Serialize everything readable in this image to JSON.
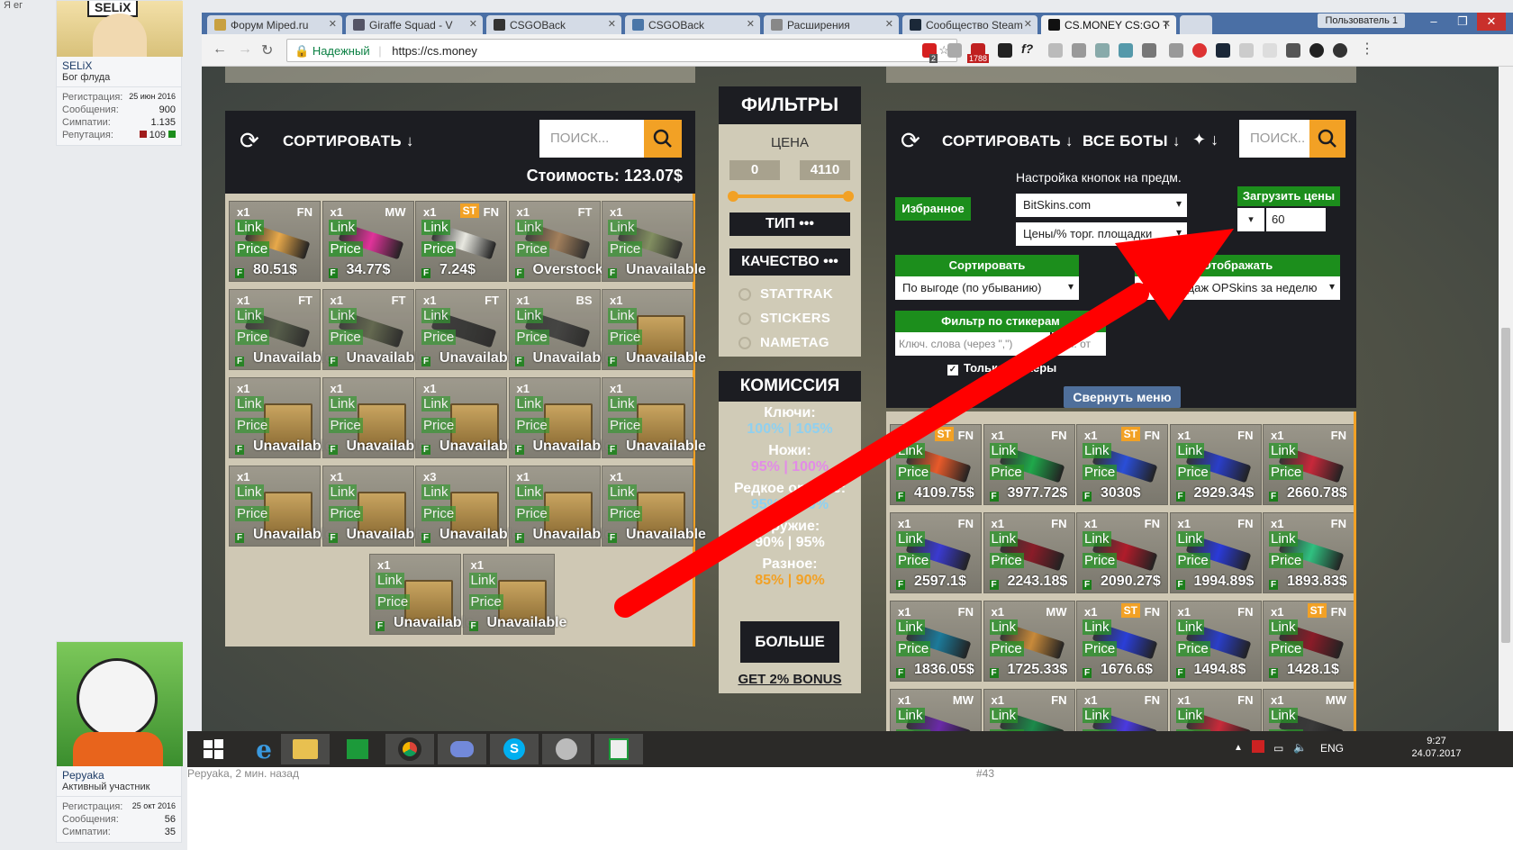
{
  "forum": {
    "top_text": "Я ег",
    "users": [
      {
        "name": "SELiX",
        "title": "Бог флуда",
        "avatar_text": "SELiX",
        "stats": [
          {
            "label": "Регистрация:",
            "value": "25 июн 2016"
          },
          {
            "label": "Сообщения:",
            "value": "900"
          },
          {
            "label": "Симпатии:",
            "value": "1.135"
          },
          {
            "label": "Репутация:",
            "value": "109"
          }
        ]
      },
      {
        "name": "Pepyaka",
        "title": "Активный участник",
        "stats": [
          {
            "label": "Регистрация:",
            "value": "25 окт 2016"
          },
          {
            "label": "Сообщения:",
            "value": "56"
          },
          {
            "label": "Симпатии:",
            "value": "35"
          }
        ]
      }
    ],
    "post_meta": "Pepyaka, 2 мин. назад",
    "post_number": "#43"
  },
  "browser": {
    "tabs": [
      {
        "label": "Форум Miped.ru",
        "active": false
      },
      {
        "label": "Giraffe Squad - V",
        "active": false
      },
      {
        "label": "CSGOBack",
        "active": false
      },
      {
        "label": "CSGOBack",
        "active": false
      },
      {
        "label": "Расширения",
        "active": false
      },
      {
        "label": "Сообщество Steam",
        "active": false
      },
      {
        "label": "CS.MONEY CS:GO T",
        "active": true
      }
    ],
    "user_badge": "Пользователь 1",
    "secure_label": "Надежный",
    "url": "https://cs.money",
    "ext_badge_1": "2",
    "ext_badge_2": "1788"
  },
  "left_panel": {
    "sort_label": "СОРТИРОВАТЬ",
    "search_placeholder": "ПОИСК...",
    "total_label": "Стоимость: 123.07$",
    "items": [
      {
        "qty": "x1",
        "wear": "FN",
        "price": "80.51$",
        "type": "gun",
        "color": "#e8a94a"
      },
      {
        "qty": "x1",
        "wear": "MW",
        "price": "34.77$",
        "type": "gun",
        "color": "#e0339a"
      },
      {
        "qty": "x1",
        "wear": "FN",
        "st": "ST",
        "price": "7.24$",
        "type": "gun",
        "color": "#e8e8e0"
      },
      {
        "qty": "x1",
        "wear": "FT",
        "price": "Overstock",
        "type": "gun",
        "color": "#a07a55",
        "dim": true
      },
      {
        "qty": "x1",
        "wear": "",
        "price": "Unavailable",
        "type": "gun",
        "color": "#7c8a5a",
        "dim": true
      },
      {
        "qty": "x1",
        "wear": "FT",
        "price": "Unavailable",
        "type": "gun",
        "color": "#4d5542",
        "dim": true
      },
      {
        "qty": "x1",
        "wear": "FT",
        "price": "Unavailable",
        "type": "gun",
        "color": "#5b6148",
        "dim": true
      },
      {
        "qty": "x1",
        "wear": "FT",
        "price": "Unavailable",
        "type": "gun",
        "color": "#2e2e2e",
        "dim": true
      },
      {
        "qty": "x1",
        "wear": "BS",
        "price": "Unavailable",
        "type": "gun",
        "color": "#3a3a3a",
        "dim": true
      },
      {
        "qty": "x1",
        "wear": "",
        "price": "Unavailable",
        "type": "box",
        "dim": true
      },
      {
        "qty": "x1",
        "wear": "",
        "price": "Unavailable",
        "type": "box",
        "dim": true
      },
      {
        "qty": "x1",
        "wear": "",
        "price": "Unavailable",
        "type": "box",
        "dim": true
      },
      {
        "qty": "x1",
        "wear": "",
        "price": "Unavailable",
        "type": "box",
        "dim": true
      },
      {
        "qty": "x1",
        "wear": "",
        "price": "Unavailable",
        "type": "box",
        "dim": true
      },
      {
        "qty": "x1",
        "wear": "",
        "price": "Unavailable",
        "type": "box",
        "dim": true
      },
      {
        "qty": "x1",
        "wear": "",
        "price": "Unavailable",
        "type": "box",
        "dim": true
      },
      {
        "qty": "x1",
        "wear": "",
        "price": "Unavailable",
        "type": "box",
        "dim": true
      },
      {
        "qty": "x3",
        "wear": "",
        "price": "Unavailable",
        "type": "box",
        "dim": true
      },
      {
        "qty": "x1",
        "wear": "",
        "price": "Unavailable",
        "type": "box",
        "dim": true
      },
      {
        "qty": "x1",
        "wear": "",
        "price": "Unavailable",
        "type": "box",
        "dim": true
      },
      {
        "qty": "x1",
        "wear": "",
        "price": "Unavailable",
        "type": "box",
        "dim": true
      },
      {
        "qty": "x1",
        "wear": "",
        "price": "Unavailable",
        "type": "box",
        "dim": true
      }
    ],
    "link_label": "Link",
    "price_label": "Price",
    "f_label": "F"
  },
  "filters": {
    "title": "ФИЛЬТРЫ",
    "price_label": "ЦЕНА",
    "price_min": "0",
    "price_max": "4110",
    "type_label": "ТИП •••",
    "quality_label": "КАЧЕСТВО •••",
    "checks": [
      "STATTRAK",
      "STICKERS",
      "NAMETAG"
    ],
    "commission_title": "КОМИССИЯ",
    "commission": [
      {
        "label": "Ключи:",
        "value": "100% | 105%",
        "color": "#8fd0f0"
      },
      {
        "label": "Ножи:",
        "value": "95% | 100%",
        "color": "#e28ce6"
      },
      {
        "label": "Редкое оружие:",
        "value": "95% | 100%",
        "color": "#8fd0f0"
      },
      {
        "label": "Оружие:",
        "value": "90% | 95%",
        "color": "#ffffff"
      },
      {
        "label": "Разное:",
        "value": "85% | 90%",
        "color": "#f2a125"
      }
    ],
    "more_label": "БОЛЬШЕ",
    "bonus_label": "GET 2% BONUS"
  },
  "right_panel": {
    "sort_label": "СОРТИРОВАТЬ",
    "bots_label": "ВСЕ БОТЫ",
    "search_placeholder": "ПОИСК..",
    "favorites_label": "Избранное",
    "button_settings_label": "Настройка кнопок на предм.",
    "source_select": "BitSkins.com",
    "price_mode_select": "Цены/% торг. площадки",
    "load_prices_label": "Загрузить цены",
    "load_prices_value": "60",
    "sort_tag": "Сортировать",
    "sort_select": "По выгоде (по убыванию)",
    "display_tag": "Отображать",
    "display_select": "Кол. продаж OPSkins за неделю",
    "sticker_filter_tag": "Фильтр по стикерам",
    "sticker_keywords_placeholder": "Ключ. слова (через \",\")",
    "sticker_count_placeholder": "Кол. от",
    "only_stickers_label": "Только стикеры",
    "collapse_label": "Свернуть меню",
    "items": [
      {
        "qty": "x1",
        "wear": "FN",
        "st": "ST",
        "price": "4109.75$",
        "color": "#e85a2a"
      },
      {
        "qty": "x1",
        "wear": "FN",
        "price": "3977.72$",
        "color": "#1fa84a"
      },
      {
        "qty": "x1",
        "wear": "FN",
        "st": "ST",
        "price": "3030$",
        "color": "#2a4ed8"
      },
      {
        "qty": "x1",
        "wear": "FN",
        "price": "2929.34$",
        "color": "#2a3ec8"
      },
      {
        "qty": "x1",
        "wear": "FN",
        "price": "2660.78$",
        "color": "#c8283a"
      },
      {
        "qty": "x1",
        "wear": "FN",
        "price": "2597.1$",
        "color": "#3a3ad0"
      },
      {
        "qty": "x1",
        "wear": "FN",
        "price": "2243.18$",
        "color": "#8a1c28"
      },
      {
        "qty": "x1",
        "wear": "FN",
        "price": "2090.27$",
        "color": "#b01c2a"
      },
      {
        "qty": "x1",
        "wear": "FN",
        "price": "1994.89$",
        "color": "#2a3ad8"
      },
      {
        "qty": "x1",
        "wear": "FN",
        "price": "1893.83$",
        "color": "#30c080"
      },
      {
        "qty": "x1",
        "wear": "FN",
        "price": "1836.05$",
        "color": "#1c7a9a"
      },
      {
        "qty": "x1",
        "wear": "MW",
        "price": "1725.33$",
        "color": "#c88a3a"
      },
      {
        "qty": "x1",
        "wear": "FN",
        "st": "ST",
        "price": "1676.6$",
        "color": "#2a3ed8"
      },
      {
        "qty": "x1",
        "wear": "FN",
        "price": "1494.8$",
        "color": "#2a3ec8"
      },
      {
        "qty": "x1",
        "wear": "FN",
        "st": "ST",
        "price": "1428.1$",
        "color": "#8a1c28"
      },
      {
        "qty": "x1",
        "wear": "MW",
        "price": "",
        "color": "#6a2aa8"
      },
      {
        "qty": "x1",
        "wear": "FN",
        "price": "",
        "color": "#1c8a4a"
      },
      {
        "qty": "x1",
        "wear": "FN",
        "price": "",
        "color": "#4a3ae0"
      },
      {
        "qty": "x1",
        "wear": "FN",
        "price": "",
        "color": "#c82a3a"
      },
      {
        "qty": "x1",
        "wear": "MW",
        "price": "",
        "color": "#3a3a3a"
      }
    ],
    "link_label": "Link",
    "price_label": "Price",
    "f_label": "F"
  },
  "taskbar": {
    "lang": "ENG",
    "time": "9:27",
    "date": "24.07.2017"
  },
  "colors": {
    "accent_orange": "#f2a125",
    "green": "#1c8e1c",
    "arrow_red": "#ff0000"
  }
}
